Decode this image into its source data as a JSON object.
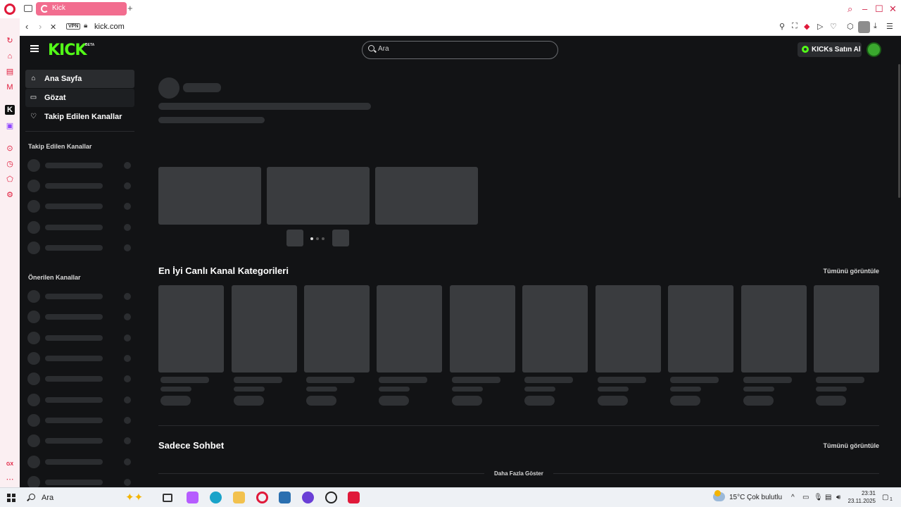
{
  "browser": {
    "tab_title": "Kick",
    "url": "kick.com",
    "vpn_label": "VPN",
    "new_tab_glyph": "+"
  },
  "header": {
    "logo_text": "KICK",
    "beta_label": "BETA",
    "search_placeholder": "Ara",
    "kicks_button_label": "KICKs Satın Al"
  },
  "sidebar": {
    "nav": [
      {
        "label": "Ana Sayfa",
        "icon": "home-icon"
      },
      {
        "label": "Gözat",
        "icon": "browse-icon"
      },
      {
        "label": "Takip Edilen Kanallar",
        "icon": "heart-icon"
      }
    ],
    "followed_heading": "Takip Edilen Kanallar",
    "recommended_heading": "Önerilen Kanallar"
  },
  "main": {
    "categories_title": "En İyi Canlı Kanal Kategorileri",
    "categories_view_all": "Tümünü görüntüle",
    "chat_title": "Sadece Sohbet",
    "chat_view_all": "Tümünü görüntüle",
    "show_more": "Daha Fazla Göster"
  },
  "taskbar": {
    "search_text": "Ara",
    "temperature": "15°C",
    "weather": "Çok bulutlu",
    "time": "23:31",
    "date": "23.11.2025",
    "notification_count": "1"
  },
  "colors": {
    "kick_green": "#53fc18",
    "page_bg": "#121315",
    "skeleton": "#3a3c3f",
    "opera_red": "#e0193a",
    "tab_pink": "#f26d8f"
  }
}
